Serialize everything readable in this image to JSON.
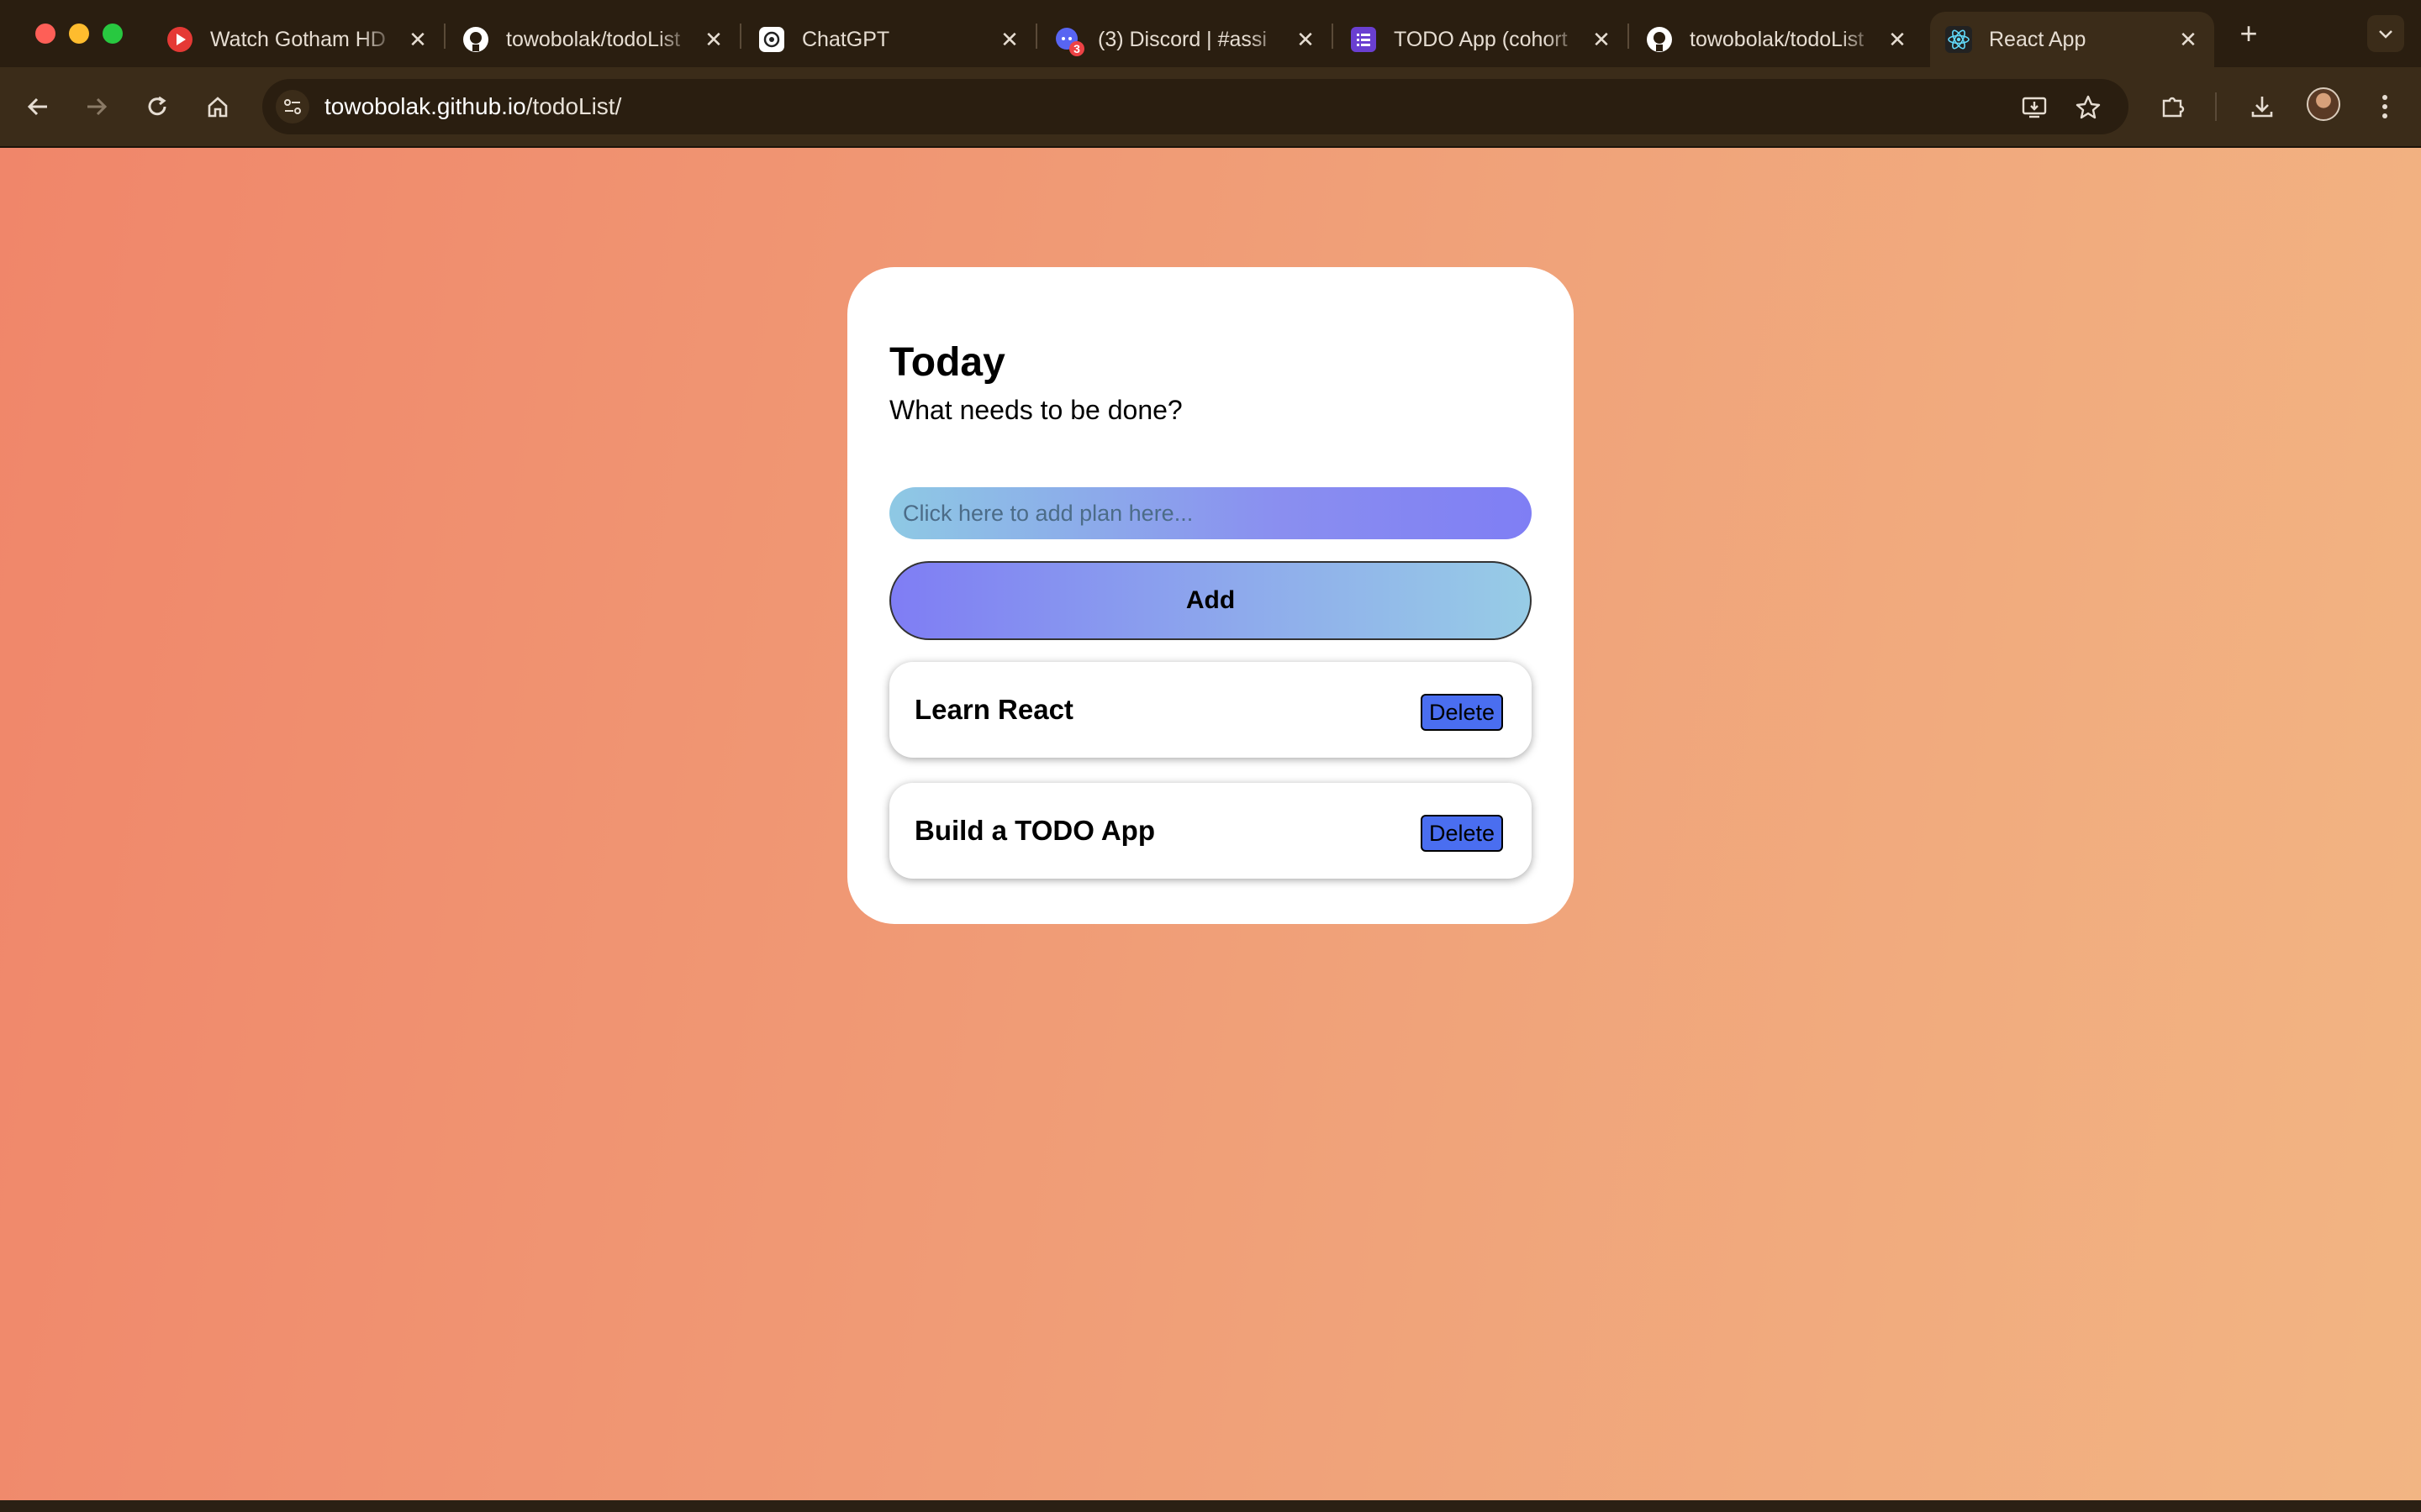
{
  "browser": {
    "tabs": [
      {
        "title": "Watch Gotham HD",
        "icon": "youtube-icon"
      },
      {
        "title": "towobolak/todoList",
        "icon": "github-icon"
      },
      {
        "title": "ChatGPT",
        "icon": "chatgpt-icon"
      },
      {
        "title": "(3) Discord | #assi",
        "icon": "discord-icon",
        "badge": "3"
      },
      {
        "title": "TODO App (cohort",
        "icon": "list-icon"
      },
      {
        "title": "towobolak/todoList",
        "icon": "github-icon"
      },
      {
        "title": "React App",
        "icon": "react-icon",
        "active": true
      }
    ],
    "url": {
      "host": "towobolak.github.io",
      "path": "/todoList/"
    }
  },
  "app": {
    "heading": "Today",
    "subtitle": "What needs to be done?",
    "input_placeholder": "Click here to add plan here...",
    "add_label": "Add",
    "todos": [
      {
        "text": "Learn React",
        "delete_label": "Delete"
      },
      {
        "text": "Build a TODO App",
        "delete_label": "Delete"
      }
    ]
  },
  "colors": {
    "page_gradient_start": "#f0866a",
    "page_gradient_end": "#f2b583",
    "delete_button": "#4a6ef0",
    "browser_chrome": "#3b2c19"
  }
}
